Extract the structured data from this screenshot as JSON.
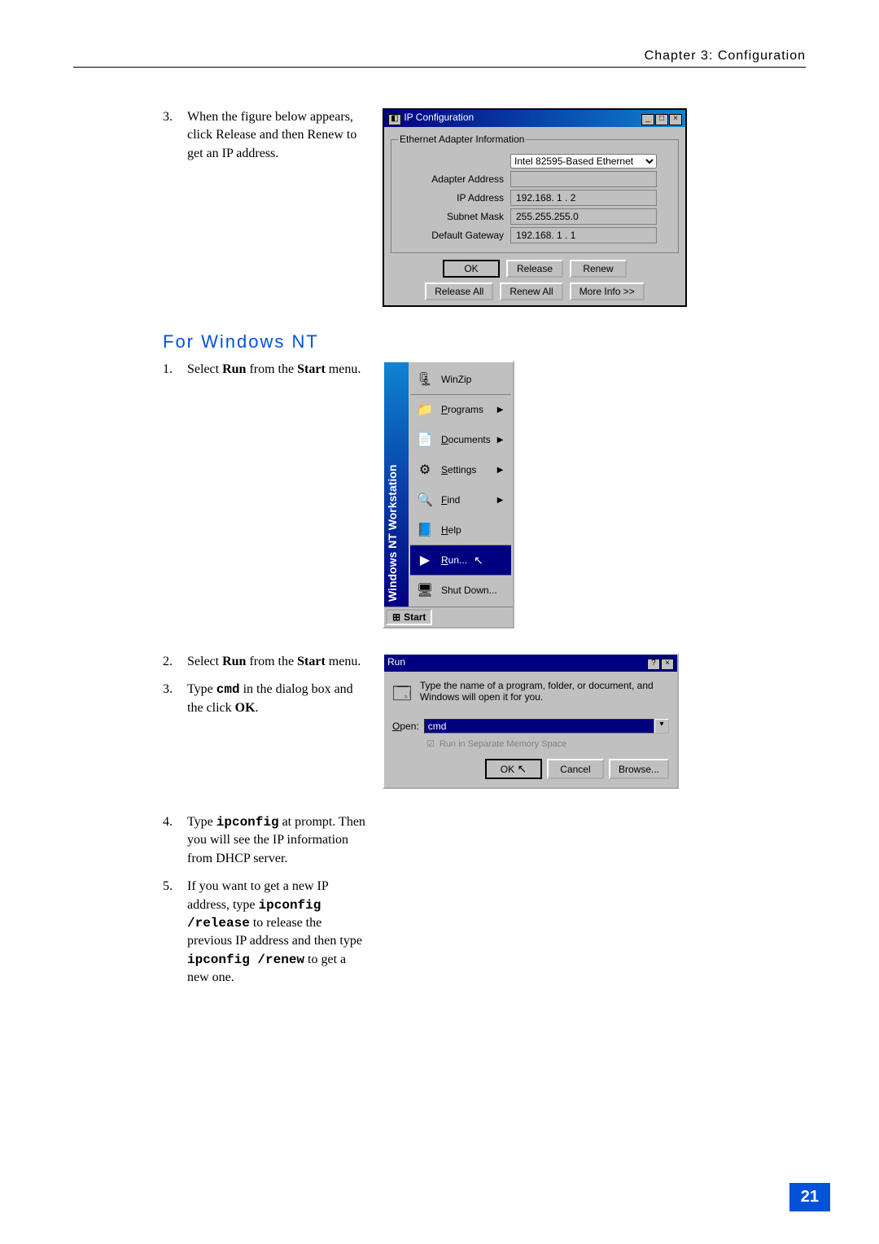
{
  "header": "Chapter 3: Configuration",
  "section1": {
    "items": [
      {
        "n": "3.",
        "t": "When the figure below appears, click Release and then Renew to get an IP address."
      }
    ]
  },
  "ipconfig": {
    "title": "IP Configuration",
    "group": "Ethernet Adapter Information",
    "adapter": "Intel 82595-Based Ethernet",
    "labels": {
      "adapter_address": "Adapter Address",
      "ip_address": "IP Address",
      "subnet_mask": "Subnet Mask",
      "default_gateway": "Default Gateway"
    },
    "values": {
      "adapter_address": "",
      "ip_address": "192.168. 1 . 2",
      "subnet_mask": "255.255.255.0",
      "default_gateway": "192.168. 1 . 1"
    },
    "buttons": {
      "ok": "OK",
      "release": "Release",
      "renew": "Renew",
      "release_all": "Release All",
      "renew_all": "Renew All",
      "more_info": "More Info >>"
    }
  },
  "section_nt": {
    "heading": "For Windows NT",
    "step1": {
      "n": "1.",
      "prefix": "Select ",
      "bold1": "Run",
      "mid": " from the ",
      "bold2": "Start",
      "suffix": " menu."
    }
  },
  "startmenu": {
    "sidebar": "Windows NT Workstation",
    "items": {
      "winzip": "WinZip",
      "programs": "Programs",
      "documents": "Documents",
      "settings": "Settings",
      "find": "Find",
      "help": "Help",
      "run": "Run...",
      "shutdown": "Shut Down..."
    },
    "start": "Start"
  },
  "section_nt2": {
    "step2": {
      "n": "2.",
      "prefix": "Select ",
      "bold1": "Run",
      "mid": " from the ",
      "bold2": "Start",
      "suffix": " menu."
    },
    "step3": {
      "n": "3.",
      "prefix": "Type ",
      "code": "cmd",
      "mid": " in the dialog box and the click ",
      "bold": "OK",
      "suffix": "."
    }
  },
  "rundlg": {
    "title": "Run",
    "desc": "Type the name of a program, folder, or document, and Windows will open it for you.",
    "open_label": "Open:",
    "open_value": "cmd",
    "chk_label": "Run in Separate Memory Space",
    "buttons": {
      "ok": "OK",
      "cancel": "Cancel",
      "browse": "Browse..."
    }
  },
  "section_nt3": {
    "step4": {
      "n": "4.",
      "prefix": "Type ",
      "code": "ipconfig",
      "suffix": " at prompt. Then you will see the IP information from DHCP server."
    },
    "step5": {
      "n": "5.",
      "prefix": "If you want to get a new IP address, type ",
      "code1": "ipconfig /release",
      "mid": " to release the previous IP address and then type ",
      "code2": "ipconfig /renew",
      "suffix": "  to get a new one."
    }
  },
  "page_number": "21"
}
